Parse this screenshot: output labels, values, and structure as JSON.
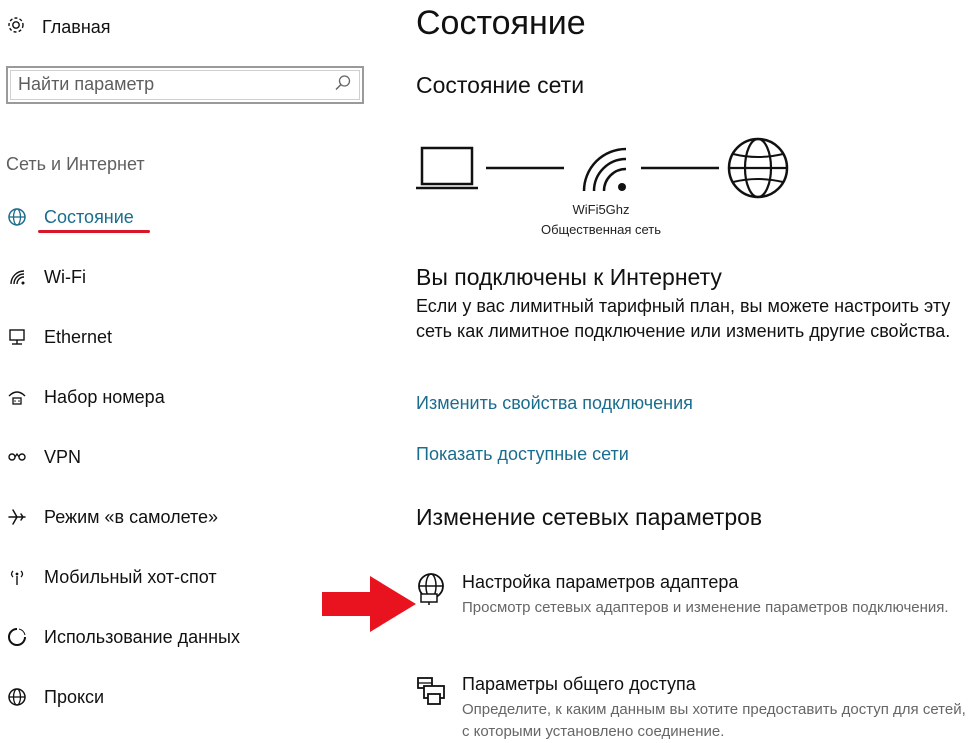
{
  "sidebar": {
    "home_label": "Главная",
    "search_placeholder": "Найти параметр",
    "section_title": "Сеть и Интернет",
    "items": [
      {
        "label": "Состояние",
        "icon": "globe-status-icon",
        "active": true
      },
      {
        "label": "Wi-Fi",
        "icon": "wifi-icon"
      },
      {
        "label": "Ethernet",
        "icon": "ethernet-icon"
      },
      {
        "label": "Набор номера",
        "icon": "dialup-icon"
      },
      {
        "label": "VPN",
        "icon": "vpn-icon"
      },
      {
        "label": "Режим «в самолете»",
        "icon": "airplane-icon"
      },
      {
        "label": "Мобильный хот-спот",
        "icon": "hotspot-icon"
      },
      {
        "label": "Использование данных",
        "icon": "data-usage-icon"
      },
      {
        "label": "Прокси",
        "icon": "proxy-globe-icon"
      }
    ]
  },
  "main": {
    "page_title": "Состояние",
    "network_status_heading": "Состояние сети",
    "network_name": "WiFi5Ghz",
    "network_type": "Общественная сеть",
    "connected_heading": "Вы подключены к Интернету",
    "connected_text": "Если у вас лимитный тарифный план, вы можете настроить эту сеть как лимитное подключение или изменить другие свойства.",
    "link_change_properties": "Изменить свойства подключения",
    "link_show_networks": "Показать доступные сети",
    "change_settings_heading": "Изменение сетевых параметров",
    "options": [
      {
        "title": "Настройка параметров адаптера",
        "desc": "Просмотр сетевых адаптеров и изменение параметров подключения.",
        "icon": "adapter-globe-icon"
      },
      {
        "title": "Параметры общего доступа",
        "desc": "Определите, к каким данным вы хотите предоставить доступ для сетей, с которыми установлено соединение.",
        "icon": "sharing-printer-icon"
      }
    ]
  },
  "colors": {
    "accent": "#1b6d8d",
    "underline": "#d8182a",
    "arrow": "#e8131e"
  }
}
